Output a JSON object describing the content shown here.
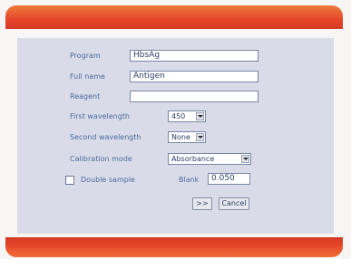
{
  "form": {
    "program": {
      "label": "Program",
      "value": "HbsAg"
    },
    "full_name": {
      "label": "Full name",
      "value": "Antigen"
    },
    "reagent": {
      "label": "Reagent",
      "value": ""
    },
    "first_wavelength": {
      "label": "First wavelength",
      "value": "450"
    },
    "second_wavelength": {
      "label": "Second wavelength",
      "value": "None"
    },
    "calibration_mode": {
      "label": "Calibration mode",
      "value": "Absorbance"
    },
    "double_sample": {
      "label": "Double sample",
      "checked": false
    },
    "blank": {
      "label": "Blank",
      "value": "0.050"
    }
  },
  "buttons": {
    "next_label": ">>",
    "cancel_label": "Cancel"
  },
  "colors": {
    "accent_band": "#e5462a",
    "panel": "#d9dce8"
  }
}
